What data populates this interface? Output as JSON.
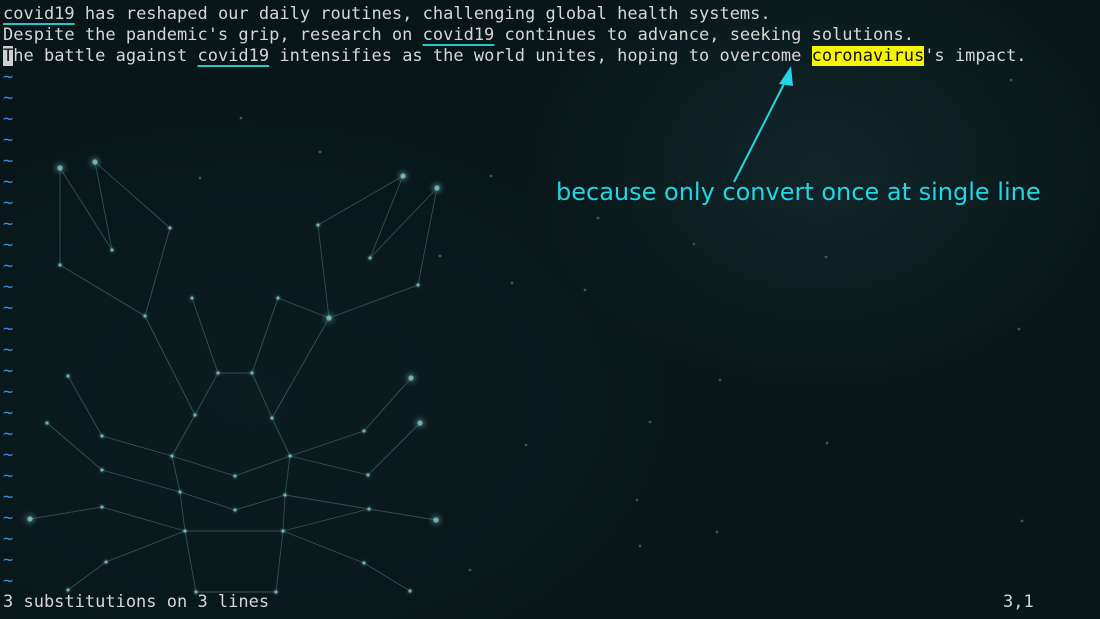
{
  "editor": {
    "lines": [
      [
        {
          "text": "covid19",
          "style": "match"
        },
        {
          "text": " has reshaped our daily routines, challenging global health systems.",
          "style": "normal"
        }
      ],
      [
        {
          "text": "Despite the pandemic's grip, research on ",
          "style": "normal"
        },
        {
          "text": "covid19",
          "style": "match"
        },
        {
          "text": " continues to advance, seeking solutions.",
          "style": "normal"
        }
      ],
      [
        {
          "text": "T",
          "style": "cursor"
        },
        {
          "text": "he battle against ",
          "style": "normal"
        },
        {
          "text": "covid19",
          "style": "match"
        },
        {
          "text": " intensifies as the world unites, hoping to overcome ",
          "style": "normal"
        },
        {
          "text": "coronavirus",
          "style": "highlight"
        },
        {
          "text": "'s impact.",
          "style": "normal"
        }
      ]
    ],
    "empty_line_marker": "~",
    "empty_line_count": 25
  },
  "annotation": {
    "text": "because only convert once at single line",
    "color": "#22d6e6"
  },
  "statusline": {
    "message": "3 substitutions on 3 lines",
    "cursor_position": "3,1"
  },
  "colors": {
    "background": "#081619",
    "text": "#d6d6d6",
    "tilde": "#3a8ee6",
    "match_underline": "#25c6c6",
    "highlight_bg": "#f5f500",
    "annotation": "#22d6e6"
  }
}
